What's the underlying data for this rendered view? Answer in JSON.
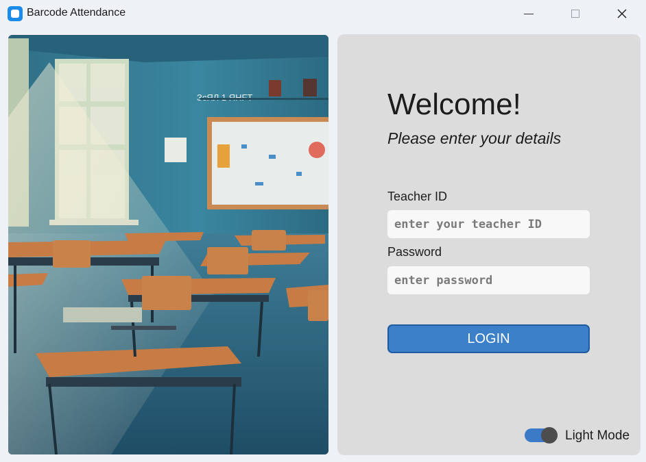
{
  "window": {
    "title": "Barcode Attendance",
    "controls": {
      "minimize": "minimize-icon",
      "maximize": "maximize-icon",
      "close": "close-icon"
    }
  },
  "hero_image": {
    "subject": "classroom-illustration",
    "wall_sign": "ЗсЯЛ 1 ЯНFТ"
  },
  "login": {
    "heading": "Welcome!",
    "subheading": "Please enter your details",
    "teacher_id": {
      "label": "Teacher ID",
      "placeholder": "enter your teacher ID",
      "value": ""
    },
    "password": {
      "label": "Password",
      "placeholder": "enter password",
      "value": ""
    },
    "button_label": "LOGIN"
  },
  "theme_toggle": {
    "label": "Light Mode",
    "on": true
  },
  "colors": {
    "accent": "#3b80c9",
    "panel": "#dcdcdc",
    "window_bg": "#eef1f6",
    "app_icon": "#1a8be8"
  }
}
